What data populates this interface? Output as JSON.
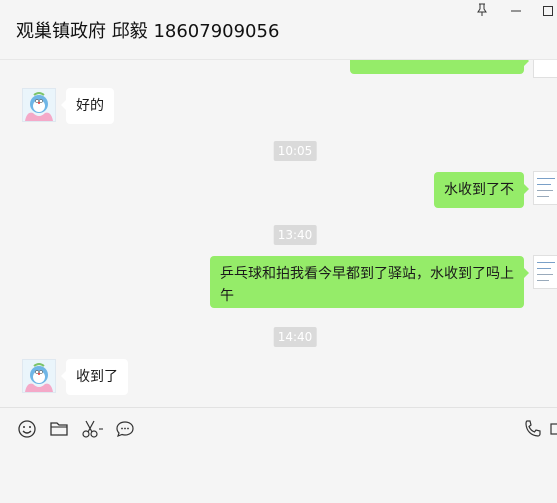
{
  "window": {
    "title": "观巢镇政府 邱毅 18607909056",
    "controls": {
      "pin": "⊥",
      "minimize": "—",
      "maximize": "□"
    }
  },
  "messages": [
    {
      "type": "text",
      "direction": "in",
      "text": "好的"
    },
    {
      "type": "time",
      "text": "10:05"
    },
    {
      "type": "text",
      "direction": "out",
      "text": "水收到了不"
    },
    {
      "type": "time",
      "text": "13:40"
    },
    {
      "type": "text",
      "direction": "out",
      "text": "乒乓球和拍我看今早都到了驿站，水收到了吗上午"
    },
    {
      "type": "time",
      "text": "14:40"
    },
    {
      "type": "text",
      "direction": "in",
      "text": "收到了"
    }
  ],
  "toolbar": {
    "icons": [
      "emoji-icon",
      "folder-icon",
      "scissors-icon",
      "chat-bubble-icon",
      "phone-icon",
      "video-icon"
    ]
  },
  "colors": {
    "outgoing_bubble": "#95ec69",
    "incoming_bubble": "#ffffff",
    "background": "#f5f5f5",
    "time_badge": "#dadada"
  }
}
